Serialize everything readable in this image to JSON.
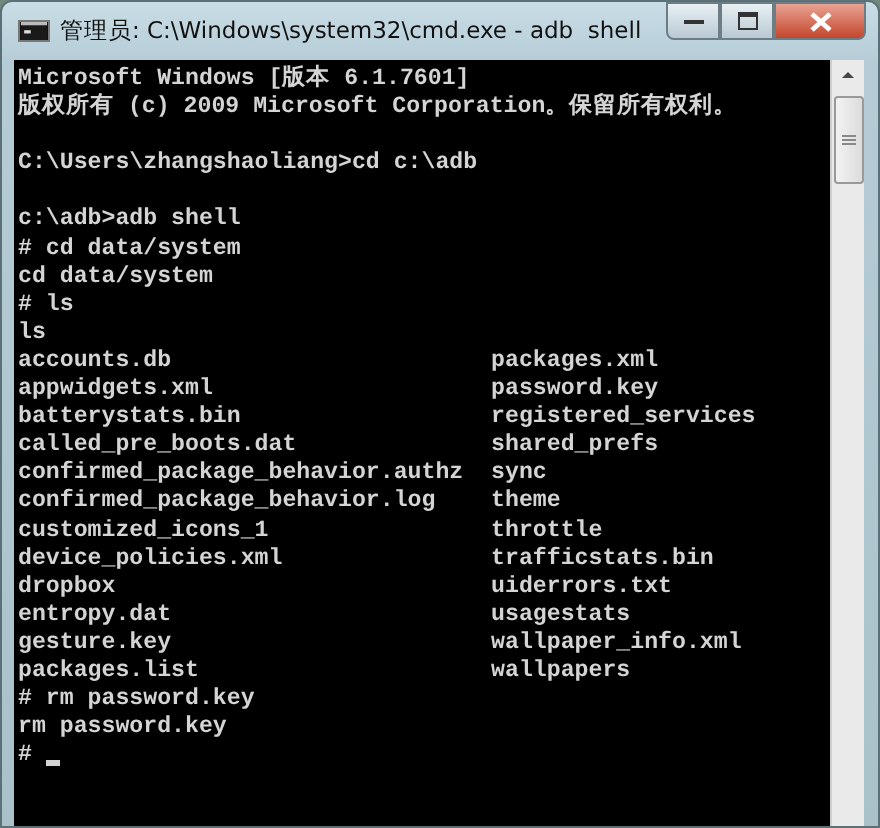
{
  "window": {
    "title": "管理员: C:\\Windows\\system32\\cmd.exe - adb  shell"
  },
  "console": {
    "lines": [
      {
        "kind": "text",
        "text": "Microsoft Windows [版本 6.1.7601]"
      },
      {
        "kind": "text",
        "text": "版权所有 (c) 2009 Microsoft Corporation。保留所有权利。"
      },
      {
        "kind": "blank"
      },
      {
        "kind": "text",
        "text": "C:\\Users\\zhangshaoliang>cd c:\\adb"
      },
      {
        "kind": "blank"
      },
      {
        "kind": "text",
        "text": "c:\\adb>adb shell"
      },
      {
        "kind": "text",
        "text": "# cd data/system"
      },
      {
        "kind": "text",
        "text": "cd data/system"
      },
      {
        "kind": "text",
        "text": "# ls"
      },
      {
        "kind": "text",
        "text": "ls"
      },
      {
        "kind": "listing",
        "columns": [
          "accounts.db",
          "packages.xml"
        ]
      },
      {
        "kind": "listing",
        "columns": [
          "appwidgets.xml",
          "password.key"
        ]
      },
      {
        "kind": "listing",
        "columns": [
          "batterystats.bin",
          "registered_services"
        ]
      },
      {
        "kind": "listing",
        "columns": [
          "called_pre_boots.dat",
          "shared_prefs"
        ]
      },
      {
        "kind": "listing",
        "columns": [
          "confirmed_package_behavior.authz",
          "sync"
        ]
      },
      {
        "kind": "listing",
        "columns": [
          "confirmed_package_behavior.log",
          "theme"
        ]
      },
      {
        "kind": "listing",
        "columns": [
          "customized_icons_1",
          "throttle"
        ]
      },
      {
        "kind": "listing",
        "columns": [
          "device_policies.xml",
          "trafficstats.bin"
        ]
      },
      {
        "kind": "listing",
        "columns": [
          "dropbox",
          "uiderrors.txt"
        ]
      },
      {
        "kind": "listing",
        "columns": [
          "entropy.dat",
          "usagestats"
        ]
      },
      {
        "kind": "listing",
        "columns": [
          "gesture.key",
          "wallpaper_info.xml"
        ]
      },
      {
        "kind": "listing",
        "columns": [
          "packages.list",
          "wallpapers"
        ]
      },
      {
        "kind": "text",
        "text": "# rm password.key"
      },
      {
        "kind": "text",
        "text": "rm password.key"
      },
      {
        "kind": "text",
        "text": "#",
        "cursor": true
      }
    ]
  }
}
